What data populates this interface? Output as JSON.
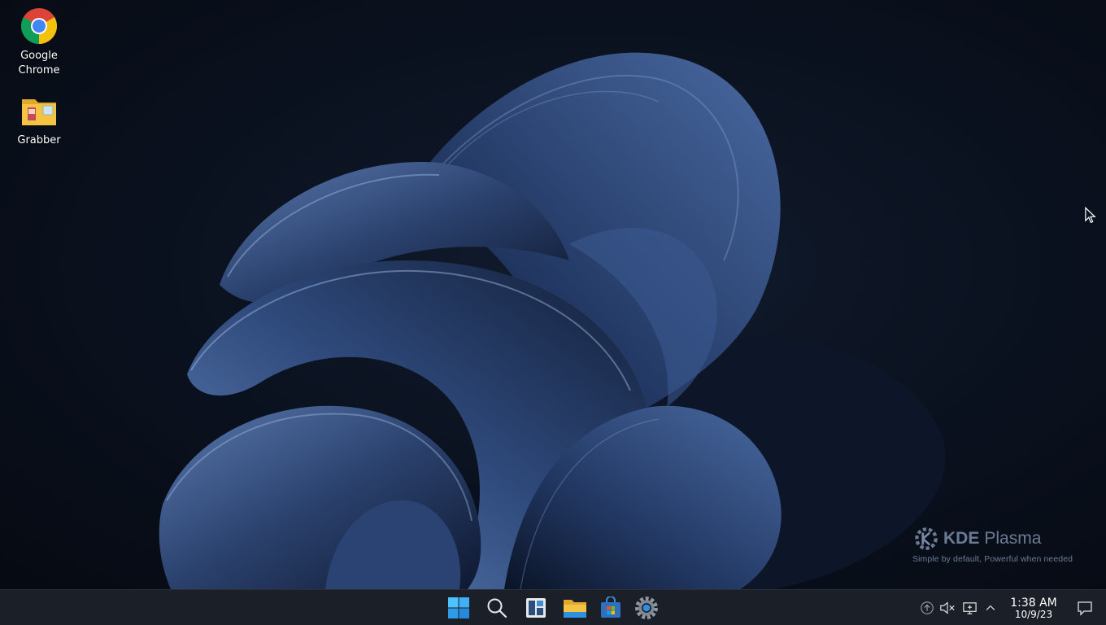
{
  "desktop": {
    "icons": [
      {
        "label": "Google\nChrome",
        "line1": "Google",
        "line2": "Chrome",
        "icon": "chrome-icon"
      },
      {
        "label": "Grabber",
        "icon": "folder-icon"
      }
    ],
    "branding": {
      "title_bold": "KDE",
      "title": "Plasma",
      "tagline": "Simple by default, Powerful when  needed"
    }
  },
  "taskbar": {
    "apps": [
      {
        "name": "start",
        "icon": "windows-start-icon"
      },
      {
        "name": "search",
        "icon": "search-icon"
      },
      {
        "name": "widgets",
        "icon": "widgets-icon"
      },
      {
        "name": "file-explorer",
        "icon": "folder-icon"
      },
      {
        "name": "store",
        "icon": "store-icon"
      },
      {
        "name": "settings",
        "icon": "gear-icon"
      }
    ],
    "tray": {
      "clock_time": "1:38 AM",
      "clock_date": "10/9/23"
    }
  },
  "colors": {
    "taskbar_bg": "#1b1f27",
    "accent_blue": "#2f8fe0",
    "folder_yellow": "#f5c342"
  }
}
